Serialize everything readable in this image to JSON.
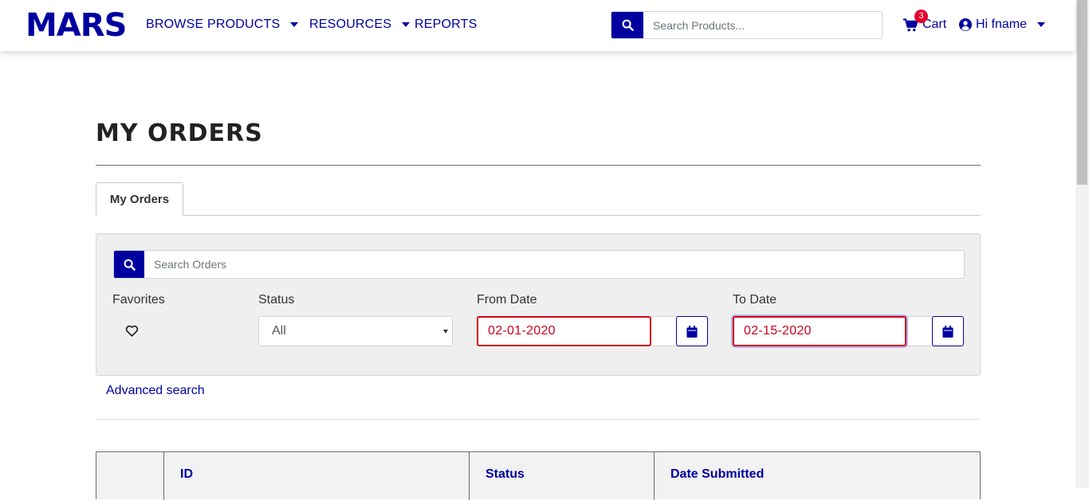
{
  "nav": {
    "logo": "MARS",
    "items": [
      {
        "label": "BROWSE PRODUCTS"
      },
      {
        "label": "RESOURCES"
      },
      {
        "label": "REPORTS"
      }
    ],
    "search_placeholder": "Search Products...",
    "cart_label": "Cart",
    "cart_count": "3",
    "user_label": "Hi fname"
  },
  "page": {
    "title": "MY ORDERS",
    "tab_label": "My Orders"
  },
  "filters": {
    "search_placeholder": "Search Orders",
    "favorites_label": "Favorites",
    "status_label": "Status",
    "status_value": "All",
    "from_date_label": "From Date",
    "from_date_value": "02-01-2020",
    "to_date_label": "To Date",
    "to_date_value": "02-15-2020",
    "advanced_search": "Advanced search"
  },
  "table": {
    "columns": [
      "",
      "ID",
      "Status",
      "Date Submitted"
    ]
  },
  "colors": {
    "brand": "#0000a0",
    "error": "#d0021b",
    "badge": "#e4002b"
  }
}
